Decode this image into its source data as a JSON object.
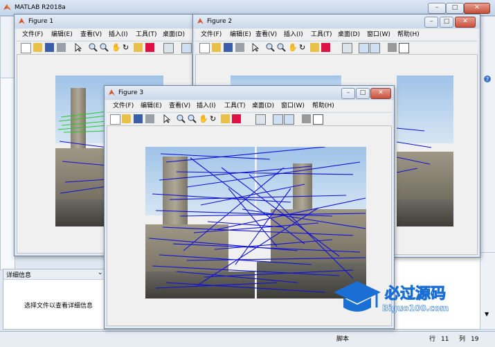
{
  "main": {
    "title": "MATLAB R2018a",
    "details_header": "详细信息",
    "details_text": "选择文件以查看详细信息",
    "status": {
      "script": "脚本",
      "row_label": "行",
      "row": "11",
      "col_label": "列",
      "col": "19"
    }
  },
  "watermark": {
    "line1": "必过源码",
    "line2": "Biguo100.com"
  },
  "figures": [
    {
      "title": "Figure 1"
    },
    {
      "title": "Figure 2"
    },
    {
      "title": "Figure 3"
    }
  ],
  "menu": {
    "file": "文件(F)",
    "edit": "编辑(E)",
    "view": "查看(V)",
    "insert": "插入(I)",
    "tools": "工具(T)",
    "desktop": "桌面(D)",
    "window": "窗口(W)",
    "help": "帮助(H)"
  },
  "window_buttons": {
    "minimize": "–",
    "maximize": "□",
    "close": "✕"
  },
  "colors": {
    "match_lines": "#1010d8",
    "inlier_lines": "#22cc22",
    "title_bar": "#cbd9ea",
    "client": "#f0f0f0"
  },
  "icons": [
    "new-file-icon",
    "open-folder-icon",
    "save-icon",
    "print-icon",
    "pointer-icon",
    "zoom-in-icon",
    "zoom-out-icon",
    "pan-hand-icon",
    "rotate-3d-icon",
    "data-cursor-icon",
    "brush-icon",
    "link-icon",
    "colorbar-icon",
    "legend-icon",
    "hide-plot-tools-icon",
    "show-plot-tools-icon"
  ]
}
